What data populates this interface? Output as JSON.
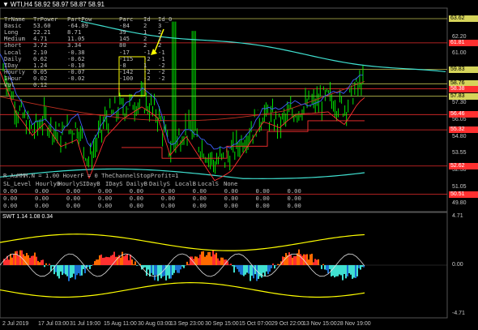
{
  "header": {
    "symbol_line": "WTI,H4  58.92 58.97 58.87 58.91",
    "dropdown_icon": "triangle-down-icon"
  },
  "table": {
    "columns": [
      "TrName",
      "TrPower",
      "PartPow",
      "Parc",
      "Id",
      "Id_0"
    ],
    "rows": [
      [
        "Basic",
        "53.60",
        "-64.89",
        "-84",
        "2",
        "3"
      ],
      [
        "Long",
        "22.21",
        "8.71",
        "39",
        "1",
        "2"
      ],
      [
        "Medium",
        "4.71",
        "11.05",
        "145",
        "2",
        "2"
      ],
      [
        "Short",
        "3.72",
        "3.34",
        "80",
        "2",
        "2"
      ],
      [
        "Local",
        "2.10",
        "-0.38",
        "-17",
        "-1",
        "-1"
      ],
      [
        "Daily",
        "0.62",
        "-0.62",
        "-115",
        "-2",
        "-1"
      ],
      [
        "IDay",
        "1.24",
        "-0.10",
        "-8",
        "1",
        "-2"
      ],
      [
        "Hourly",
        "0.05",
        "-0.07",
        "-142",
        "-2",
        "-2"
      ],
      [
        "IHour",
        "0.02",
        "-0.02",
        "-100",
        "-2",
        "-2"
      ],
      [
        "Vol",
        "0.12",
        "",
        "",
        "",
        ""
      ]
    ]
  },
  "lower_info": {
    "line1": "R_AuMMM.N = 1.00    HoverF = 0    TheChannelStopProfit=1",
    "columns": [
      "SL_Level",
      "HourlyB",
      "HourlyS",
      "IDayB",
      "IDayS",
      "DailyB",
      "DailyS",
      "LocalB",
      "LocalS",
      "None"
    ],
    "zero_rows": [
      "0.00     0.00     0.00     0.00     0.00     0.00     0.00     0.00     0.00     0.00",
      "0.00     0.00     0.00     0.00     0.00     0.00     0.00     0.00     0.00     0.00",
      "0.00     0.00     0.00     0.00     0.00     0.00     0.00     0.00     0.00     0.00"
    ]
  },
  "price_scale": {
    "ticks": [
      "62.20",
      "61.00",
      "59.80",
      "58.60",
      "57.30",
      "56.05",
      "54.80",
      "53.55",
      "52.30",
      "51.05",
      "49.80"
    ],
    "labels": [
      {
        "text": "63.62",
        "color": "#d6d45a"
      },
      {
        "text": "61.81",
        "color": "#ff3030"
      },
      {
        "text": "59.83",
        "color": "#d6d45a"
      },
      {
        "text": "58.76",
        "color": "#d6d45a"
      },
      {
        "text": "58.38",
        "color": "#ff3030"
      },
      {
        "text": "57.83",
        "color": "#d6d45a"
      },
      {
        "text": "56.46",
        "color": "#ff3030"
      },
      {
        "text": "55.32",
        "color": "#ff3030"
      },
      {
        "text": "52.62",
        "color": "#ff3030"
      },
      {
        "text": "50.51",
        "color": "#ff3030"
      }
    ]
  },
  "subwindow": {
    "title": "SWT 1.14 1.08 0.34",
    "ticks": [
      "4.71",
      "0.00",
      "-4.71"
    ]
  },
  "time_axis": [
    "2 Jul 2019",
    "17 Jul 03:00",
    "31 Jul 19:00",
    "15 Aug 11:00",
    "30 Aug 03:00",
    "13 Sep 23:00",
    "30 Sep 15:00",
    "15 Oct 07:00",
    "29 Oct 22:00",
    "13 Nov 15:00",
    "28 Nov 19:00"
  ],
  "colors": {
    "background": "#000000",
    "candles": "#00ff00",
    "aqua": "#40e0d0",
    "red": "#ff3030",
    "yellow": "#ffff00",
    "orange": "#ff6a00",
    "navy": "#4060ff",
    "grid": "#303030"
  }
}
